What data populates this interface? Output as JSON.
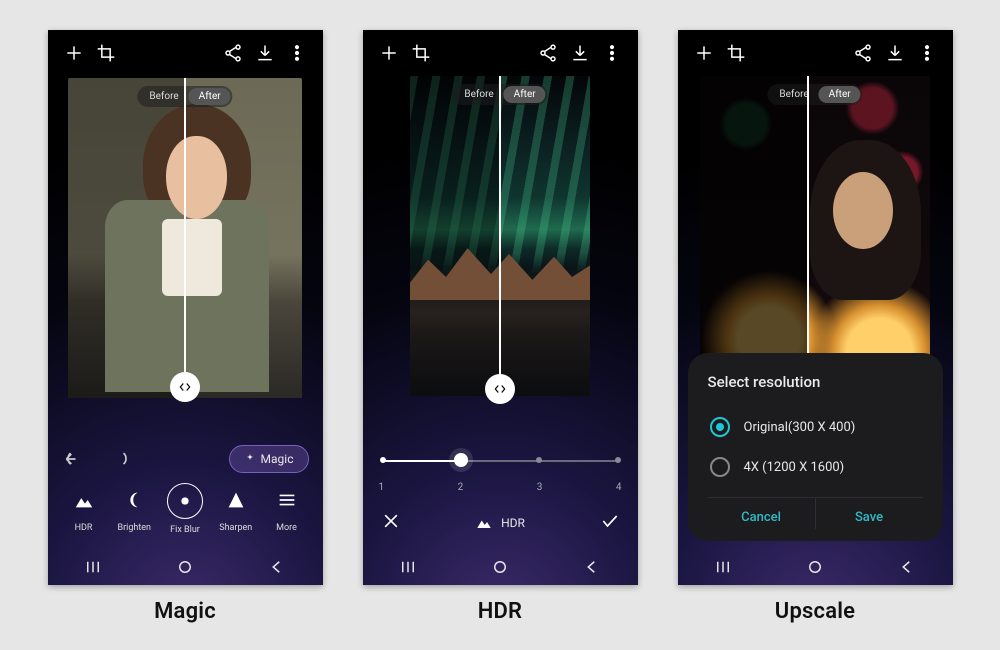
{
  "captions": {
    "magic": "Magic",
    "hdr": "HDR",
    "upscale": "Upscale"
  },
  "compare": {
    "before": "Before",
    "after": "After"
  },
  "magic_button": "Magic",
  "tools": {
    "hdr": {
      "label": "HDR"
    },
    "brighten": {
      "label": "Brighten"
    },
    "fixblur": {
      "label": "Fix Blur"
    },
    "sharpen": {
      "label": "Sharpen"
    },
    "more": {
      "label": "More"
    }
  },
  "hdr_panel": {
    "label": "HDR",
    "min": 1,
    "max": 4,
    "value": 2,
    "ticks": [
      "1",
      "2",
      "3",
      "4"
    ]
  },
  "upscale_dialog": {
    "title": "Select resolution",
    "options": {
      "original": {
        "label": "Original(300 X 400)",
        "selected": true
      },
      "x4": {
        "label": "4X (1200 X 1600)",
        "selected": false
      }
    },
    "cancel": "Cancel",
    "save": "Save"
  }
}
